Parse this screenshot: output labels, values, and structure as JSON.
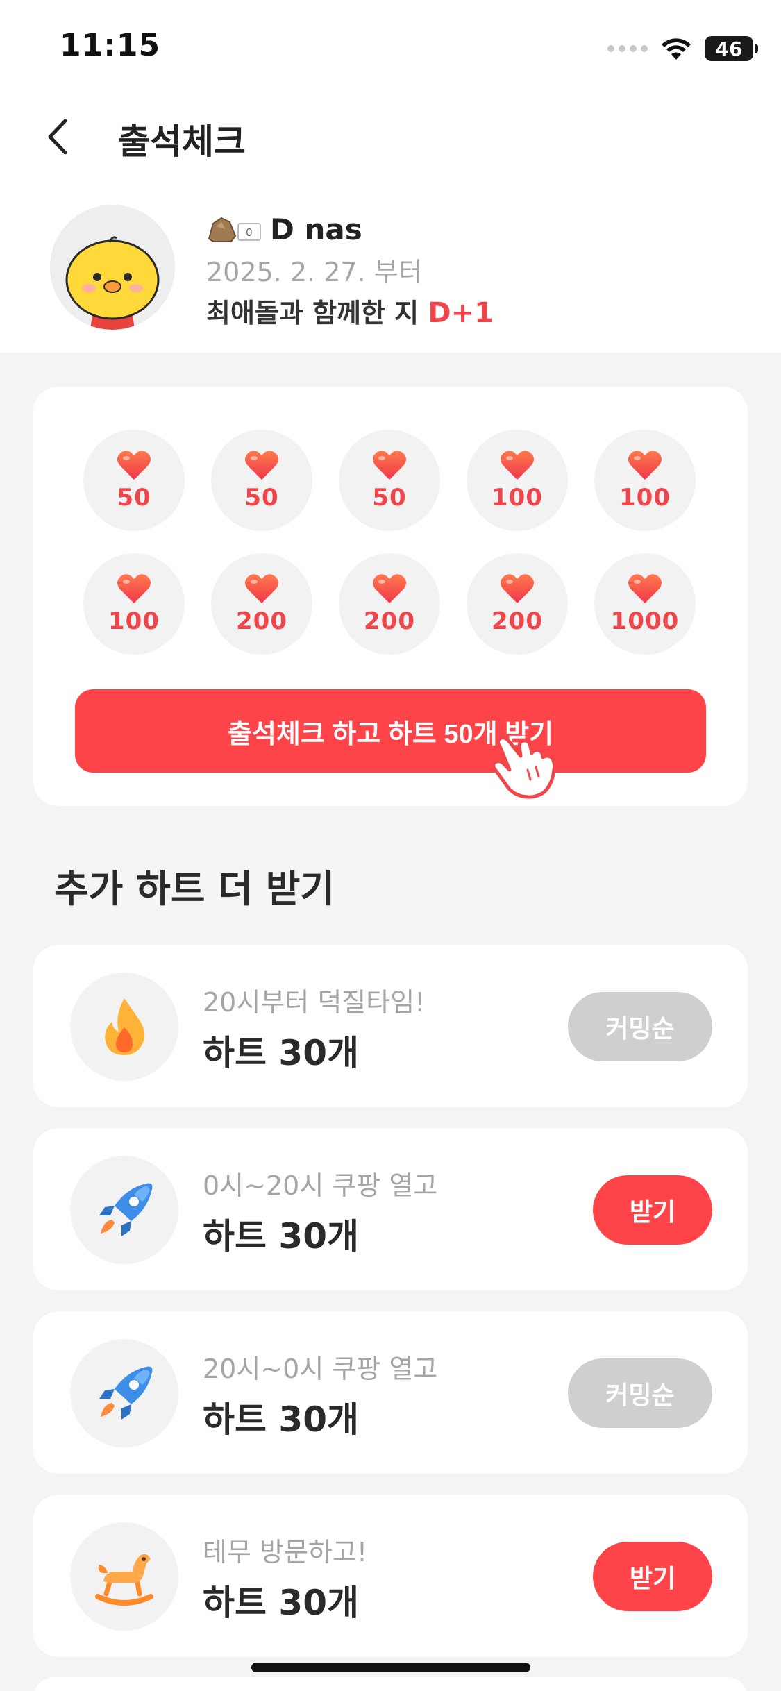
{
  "status_bar": {
    "time": "11:15",
    "battery": "46",
    "icons": [
      "signal-dots-icon",
      "wifi-icon",
      "battery-icon"
    ]
  },
  "nav": {
    "title": "출석체크",
    "back_icon": "chevron-left-icon"
  },
  "profile": {
    "rank_badge_value": "0",
    "name": "D nas",
    "since_date": "2025. 2. 27. 부터",
    "together_text": "최애돌과 함께한 지",
    "dday": "D+1"
  },
  "attendance": {
    "rewards": [
      "50",
      "50",
      "50",
      "100",
      "100",
      "100",
      "200",
      "200",
      "200",
      "1000"
    ],
    "button_label": "출석체크 하고 하트 50개 받기"
  },
  "extra": {
    "section_title": "추가 하트 더 받기",
    "missions": [
      {
        "icon": "fire-icon",
        "subtitle": "20시부터 덕질타임!",
        "reward": "하트 30개",
        "button": "커밍순",
        "enabled": false
      },
      {
        "icon": "rocket-icon",
        "subtitle": "0시~20시 쿠팡 열고",
        "reward": "하트 30개",
        "button": "받기",
        "enabled": true
      },
      {
        "icon": "rocket-icon",
        "subtitle": "20시~0시 쿠팡 열고",
        "reward": "하트 30개",
        "button": "커밍순",
        "enabled": false
      },
      {
        "icon": "rocking-horse-icon",
        "subtitle": "테무 방문하고!",
        "reward": "하트 30개",
        "button": "받기",
        "enabled": true
      }
    ]
  },
  "colors": {
    "accent": "#fe4448",
    "heart": "#f0454a",
    "disabled_button": "#cfcfcf",
    "background": "#f4f4f4"
  }
}
